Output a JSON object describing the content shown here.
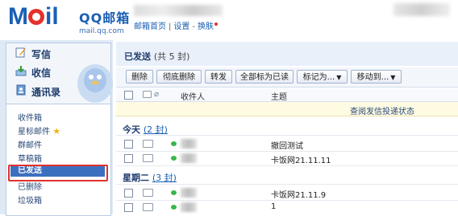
{
  "header": {
    "brand_main": "QQ邮箱",
    "brand_sub": "mail.qq.com",
    "links": [
      "邮箱首页",
      "设置",
      "换肤"
    ]
  },
  "sidebar": {
    "actions": [
      {
        "label": "写信",
        "icon": "compose-icon"
      },
      {
        "label": "收信",
        "icon": "inbox-download-icon"
      },
      {
        "label": "通讯录",
        "icon": "contacts-icon"
      }
    ],
    "folders": [
      "收件箱",
      "星标邮件",
      "群邮件",
      "草稿箱",
      "已发送",
      "已删除",
      "垃圾箱"
    ],
    "selected_folder": "已发送"
  },
  "main": {
    "title": "已发送",
    "count_text": "(共 5 封)",
    "toolbar": {
      "delete": "删除",
      "delete_permanent": "彻底删除",
      "forward": "转发",
      "mark_all_read": "全部标为已读",
      "mark_as": "标记为...",
      "move_to": "移动到..."
    },
    "columns": {
      "recipient": "收件人",
      "subject": "主题"
    },
    "notice": "查阅发信投递状态",
    "groups": [
      {
        "label": "今天",
        "count": "(2 封)",
        "rows": [
          {
            "subject": "撤回测试"
          },
          {
            "subject": "卡饭网21.11.11"
          }
        ]
      },
      {
        "label": "星期二",
        "count": "(3 封)",
        "rows": [
          {
            "subject": "卡饭网21.11.9"
          },
          {
            "subject": "1"
          }
        ]
      }
    ]
  },
  "colors": {
    "accent": "#1a5fb4",
    "selected": "#3d6fbf",
    "highlight_box": "#e0322d"
  }
}
